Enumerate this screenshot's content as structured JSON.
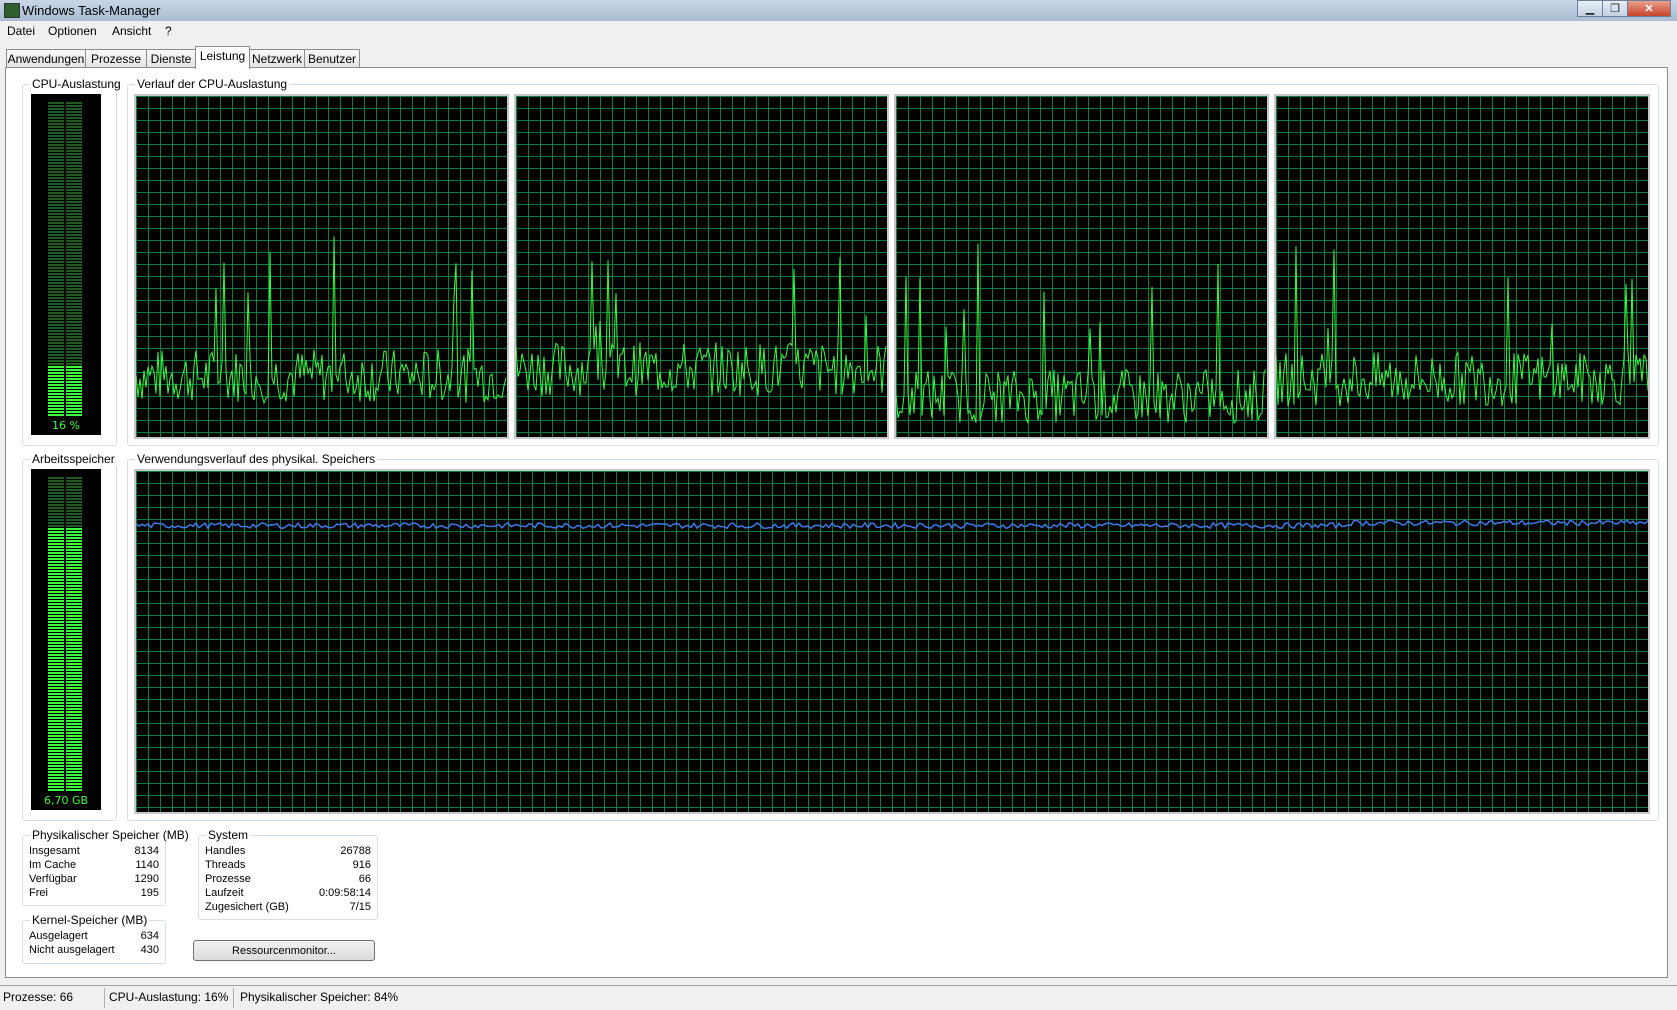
{
  "window": {
    "title": "Windows Task-Manager",
    "buttons": {
      "minimize": "▁",
      "maximize": "❐",
      "close": "✕"
    }
  },
  "menu": [
    "Datei",
    "Optionen",
    "Ansicht",
    "?"
  ],
  "tabs": [
    "Anwendungen",
    "Prozesse",
    "Dienste",
    "Leistung",
    "Netzwerk",
    "Benutzer"
  ],
  "active_tab": "Leistung",
  "cpu": {
    "group_label": "CPU-Auslastung",
    "value_text": "16 %",
    "level_percent": 16,
    "history_label": "Verlauf der CPU-Auslastung",
    "core_avg_percent": [
      18,
      20,
      12,
      17
    ]
  },
  "memory": {
    "group_label": "Arbeitsspeicher",
    "value_text": "6,70 GB",
    "level_percent": 84,
    "history_label": "Verwendungsverlauf des physikal. Speichers",
    "line_color": "#3d7be8"
  },
  "colors": {
    "graph_grid": "#008040",
    "cpu_line": "#3cfa3c",
    "meter_on": "#3cfa3c",
    "meter_off": "#1e5a1e"
  },
  "physical_memory": {
    "label": "Physikalischer Speicher (MB)",
    "rows": [
      {
        "key": "Insgesamt",
        "value": "8134"
      },
      {
        "key": "Im Cache",
        "value": "1140"
      },
      {
        "key": "Verfügbar",
        "value": "1290"
      },
      {
        "key": "Frei",
        "value": "195"
      }
    ]
  },
  "kernel_memory": {
    "label": "Kernel-Speicher (MB)",
    "rows": [
      {
        "key": "Ausgelagert",
        "value": "634"
      },
      {
        "key": "Nicht ausgelagert",
        "value": "430"
      }
    ]
  },
  "system": {
    "label": "System",
    "rows": [
      {
        "key": "Handles",
        "value": "26788"
      },
      {
        "key": "Threads",
        "value": "916"
      },
      {
        "key": "Prozesse",
        "value": "66"
      },
      {
        "key": "Laufzeit",
        "value": "0:09:58:14"
      },
      {
        "key": "Zugesichert (GB)",
        "value": "7/15"
      }
    ]
  },
  "resource_button": "Ressourcenmonitor...",
  "statusbar": {
    "processes": "Prozesse: 66",
    "cpu": "CPU-Auslastung: 16%",
    "memory": "Physikalischer Speicher: 84%"
  }
}
